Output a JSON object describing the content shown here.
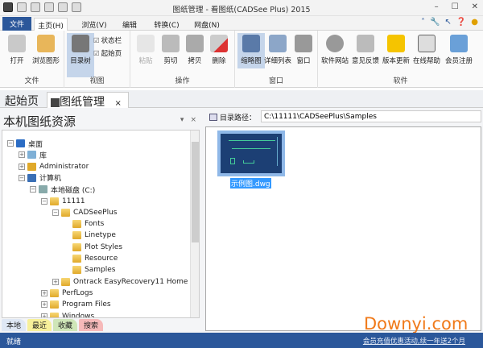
{
  "window": {
    "title": "图纸管理 - 看图纸(CADSee Plus) 2015",
    "minimize": "–",
    "maximize": "☐",
    "close": "✕"
  },
  "menu": {
    "file": "文件",
    "tabs": [
      "主页(H)",
      "浏览(V)",
      "编辑",
      "转换(C)",
      "网盘(N)"
    ],
    "active": "主页(H)"
  },
  "ribbon": {
    "groups": [
      {
        "label": "文件",
        "buttons": [
          "打开",
          "浏览图形"
        ]
      },
      {
        "label": "视图",
        "buttons": [
          "目录树"
        ],
        "checkboxes": [
          "状态栏",
          "起始页"
        ]
      },
      {
        "label": "操作",
        "buttons": [
          "粘贴",
          "剪切",
          "拷贝",
          "删除"
        ]
      },
      {
        "label": "窗口",
        "buttons": [
          "缩略图",
          "详细列表",
          "窗口"
        ]
      },
      {
        "label": "软件",
        "buttons": [
          "软件网站",
          "意见反馈",
          "版本更新",
          "在线帮助",
          "会员注册"
        ]
      }
    ]
  },
  "doc_tabs": {
    "start": "起始页",
    "manager": "图纸管理",
    "close": "×"
  },
  "left_panel": {
    "title": "本机图纸资源",
    "pin": "▾",
    "close": "×",
    "tree": [
      {
        "label": "桌面",
        "level": 0,
        "exp": "−",
        "icon": "desktop"
      },
      {
        "label": "库",
        "level": 1,
        "exp": "+",
        "icon": "lib"
      },
      {
        "label": "Administrator",
        "level": 1,
        "exp": "+",
        "icon": "user"
      },
      {
        "label": "计算机",
        "level": 1,
        "exp": "−",
        "icon": "pc"
      },
      {
        "label": "本地磁盘 (C:)",
        "level": 2,
        "exp": "−",
        "icon": "drive"
      },
      {
        "label": "11111",
        "level": 3,
        "exp": "−",
        "icon": "folder"
      },
      {
        "label": "CADSeePlus",
        "level": 4,
        "exp": "−",
        "icon": "folder"
      },
      {
        "label": "Fonts",
        "level": 5,
        "exp": "",
        "icon": "folder"
      },
      {
        "label": "Linetype",
        "level": 5,
        "exp": "",
        "icon": "folder"
      },
      {
        "label": "Plot Styles",
        "level": 5,
        "exp": "",
        "icon": "folder"
      },
      {
        "label": "Resource",
        "level": 5,
        "exp": "",
        "icon": "folder"
      },
      {
        "label": "Samples",
        "level": 5,
        "exp": "",
        "icon": "folder"
      },
      {
        "label": "Ontrack EasyRecovery11 Home",
        "level": 4,
        "exp": "+",
        "icon": "folder"
      },
      {
        "label": "PerfLogs",
        "level": 3,
        "exp": "+",
        "icon": "folder"
      },
      {
        "label": "Program Files",
        "level": 3,
        "exp": "+",
        "icon": "folder"
      },
      {
        "label": "Windows",
        "level": 3,
        "exp": "+",
        "icon": "folder"
      }
    ],
    "bottom_tabs": [
      {
        "label": "本地",
        "color": "#dfe8f5"
      },
      {
        "label": "最近",
        "color": "#f7f09a"
      },
      {
        "label": "收藏",
        "color": "#cfe6b8"
      },
      {
        "label": "搜索",
        "color": "#f6b9b9"
      }
    ]
  },
  "right_panel": {
    "path_label": "目录路径：",
    "path_value": "C:\\11111\\CADSeePlus\\Samples",
    "files": [
      {
        "name": "示例图.dwg",
        "selected": true
      }
    ]
  },
  "status": {
    "text": "就绪",
    "promo": "会员充值优惠活动,续一年送2个月"
  },
  "watermark": "Downyi.com",
  "colors": {
    "accent": "#2b579a",
    "selection": "#3399ff"
  }
}
